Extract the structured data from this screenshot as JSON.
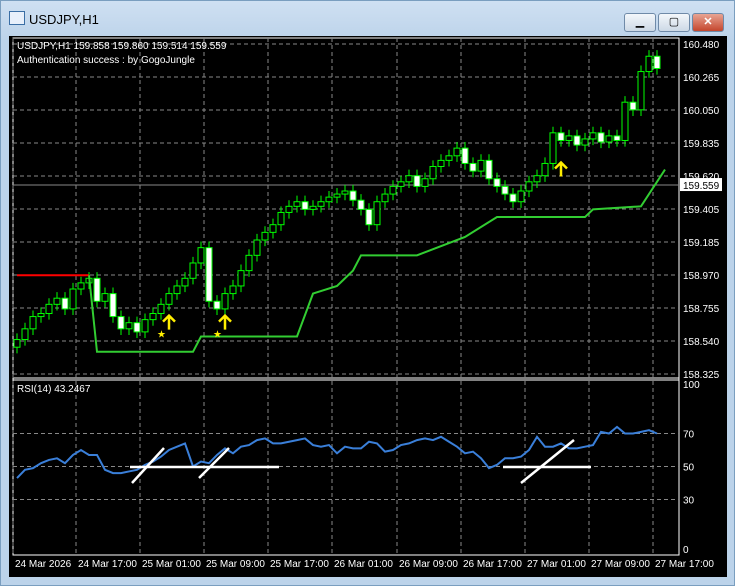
{
  "window": {
    "title": "USDJPY,H1",
    "minimize": "▁",
    "maximize": "▢",
    "close": "✕"
  },
  "header": {
    "symbol_line": "USDJPY,H1  159.858 159.860 159.514 159.559",
    "auth_text": "Authentication success : by GogoJungle"
  },
  "price_axis": {
    "labels": [
      "160.480",
      "160.265",
      "160.050",
      "159.835",
      "159.620",
      "159.405",
      "159.185",
      "158.970",
      "158.755",
      "158.540",
      "158.325"
    ],
    "current_price": "159.559"
  },
  "rsi": {
    "label": "RSI(14) 43.2467",
    "levels": [
      "100",
      "70",
      "50",
      "30",
      "0"
    ]
  },
  "time_axis": [
    "24 Mar 2026",
    "24 Mar 17:00",
    "25 Mar 01:00",
    "25 Mar 09:00",
    "25 Mar 17:00",
    "26 Mar 01:00",
    "26 Mar 09:00",
    "26 Mar 17:00",
    "27 Mar 01:00",
    "27 Mar 09:00",
    "27 Mar 17:00"
  ],
  "colors": {
    "bull": "#00ff00",
    "trend": "#32cd32",
    "trend_down": "#ff0000",
    "rsi": "#3a7fd9",
    "signal": "#ffee00"
  },
  "chart_data": {
    "type": "candlestick",
    "price_range": [
      158.325,
      160.48
    ],
    "closes": [
      158.55,
      158.62,
      158.7,
      158.72,
      158.78,
      158.82,
      158.75,
      158.88,
      158.92,
      158.95,
      158.8,
      158.85,
      158.7,
      158.62,
      158.66,
      158.6,
      158.68,
      158.72,
      158.78,
      158.85,
      158.9,
      158.95,
      159.05,
      159.15,
      158.8,
      158.75,
      158.85,
      158.9,
      159.0,
      159.1,
      159.2,
      159.25,
      159.3,
      159.38,
      159.42,
      159.45,
      159.4,
      159.42,
      159.45,
      159.48,
      159.5,
      159.52,
      159.46,
      159.4,
      159.3,
      159.45,
      159.5,
      159.55,
      159.58,
      159.62,
      159.55,
      159.6,
      159.68,
      159.72,
      159.75,
      159.8,
      159.7,
      159.65,
      159.72,
      159.6,
      159.55,
      159.5,
      159.45,
      159.52,
      159.58,
      159.62,
      159.7,
      159.9,
      159.85,
      159.88,
      159.82,
      159.86,
      159.9,
      159.84,
      159.88,
      159.85,
      160.1,
      160.05,
      160.3,
      160.4,
      160.32
    ],
    "trend_down": [
      [
        0,
        158.97
      ],
      [
        9,
        158.97
      ]
    ],
    "trend_up": [
      [
        9,
        158.97
      ],
      [
        10,
        158.47
      ],
      [
        22,
        158.47
      ],
      [
        23,
        158.57
      ],
      [
        35,
        158.57
      ],
      [
        37,
        158.85
      ],
      [
        40,
        158.9
      ],
      [
        42,
        159.0
      ],
      [
        43,
        159.1
      ],
      [
        50,
        159.1
      ],
      [
        56,
        159.22
      ],
      [
        60,
        159.35
      ],
      [
        71,
        159.35
      ],
      [
        72,
        159.4
      ],
      [
        78,
        159.42
      ],
      [
        80,
        159.58
      ],
      [
        81,
        159.66
      ]
    ],
    "signals": [
      19,
      26,
      68
    ],
    "rsi_values": [
      43,
      48,
      49,
      52,
      54,
      55,
      52,
      57,
      60,
      57,
      57,
      48,
      46,
      46,
      47,
      48,
      51,
      53,
      56,
      60,
      62,
      64,
      50,
      53,
      52,
      57,
      61,
      58,
      62,
      63,
      66,
      67,
      64,
      64,
      65,
      66,
      67,
      63,
      62,
      63,
      58,
      62,
      61,
      61,
      65,
      64,
      59,
      60,
      63,
      64,
      66,
      67,
      66,
      68,
      65,
      62,
      58,
      59,
      55,
      49,
      51,
      55,
      55,
      56,
      60,
      68,
      62,
      62,
      64,
      61,
      61,
      62,
      63,
      71,
      70,
      74,
      70,
      70,
      71,
      72,
      70
    ],
    "rsi_range": [
      0,
      100
    ]
  }
}
